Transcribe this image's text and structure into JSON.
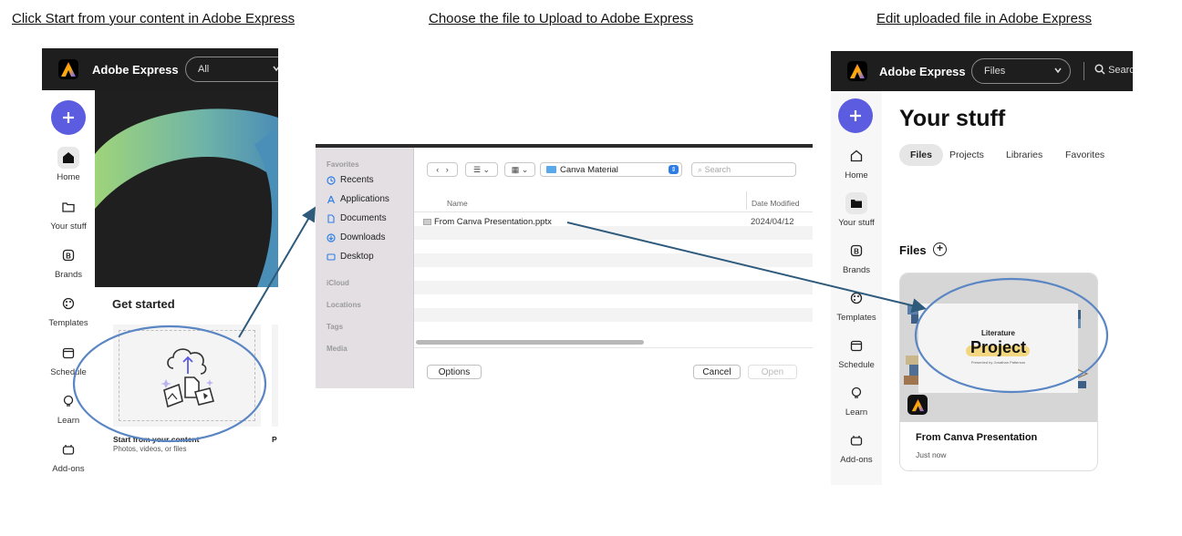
{
  "captions": {
    "step1": "Click Start from your content in Adobe Express",
    "step2": "Choose the file to Upload to Adobe Express",
    "step3": "Edit uploaded file in Adobe Express"
  },
  "brand": {
    "name": "Adobe Express",
    "accent": "#5c5ce0",
    "annotation_color": "#5b86c4",
    "arrow_color": "#2e5a7c"
  },
  "panel1": {
    "search_scope": "All",
    "rail": [
      "Home",
      "Your stuff",
      "Brands",
      "Templates",
      "Schedule",
      "Learn",
      "Add-ons"
    ],
    "section_title": "Get started",
    "start_card": {
      "title": "Start from your content",
      "subtitle": "Photos, videos, or files"
    },
    "next_card_truncated": "P"
  },
  "panel2": {
    "sidebar": {
      "favorites_heading": "Favorites",
      "favorites": [
        "Recents",
        "Applications",
        "Documents",
        "Downloads",
        "Desktop"
      ],
      "other_headings": [
        "iCloud",
        "Locations",
        "Tags",
        "Media"
      ]
    },
    "folder": "Canva Material",
    "search_placeholder": "Search",
    "columns": {
      "name": "Name",
      "date": "Date Modified"
    },
    "file": {
      "name": "From Canva Presentation.pptx",
      "date": "2024/04/12"
    },
    "buttons": {
      "options": "Options",
      "cancel": "Cancel",
      "open": "Open"
    }
  },
  "panel3": {
    "search_scope": "Files",
    "search_placeholder": "Searc",
    "rail": [
      "Home",
      "Your stuff",
      "Brands",
      "Templates",
      "Schedule",
      "Learn",
      "Add-ons"
    ],
    "page_title": "Your stuff",
    "tabs": [
      "Files",
      "Projects",
      "Libraries",
      "Favorites"
    ],
    "active_tab": "Files",
    "files_heading": "Files",
    "files_add": "+",
    "project": {
      "thumb_line1": "Literature",
      "thumb_line2": "Project",
      "thumb_line3": "Presented by Jonathan Patterson",
      "name": "From Canva Presentation",
      "time": "Just now"
    }
  }
}
